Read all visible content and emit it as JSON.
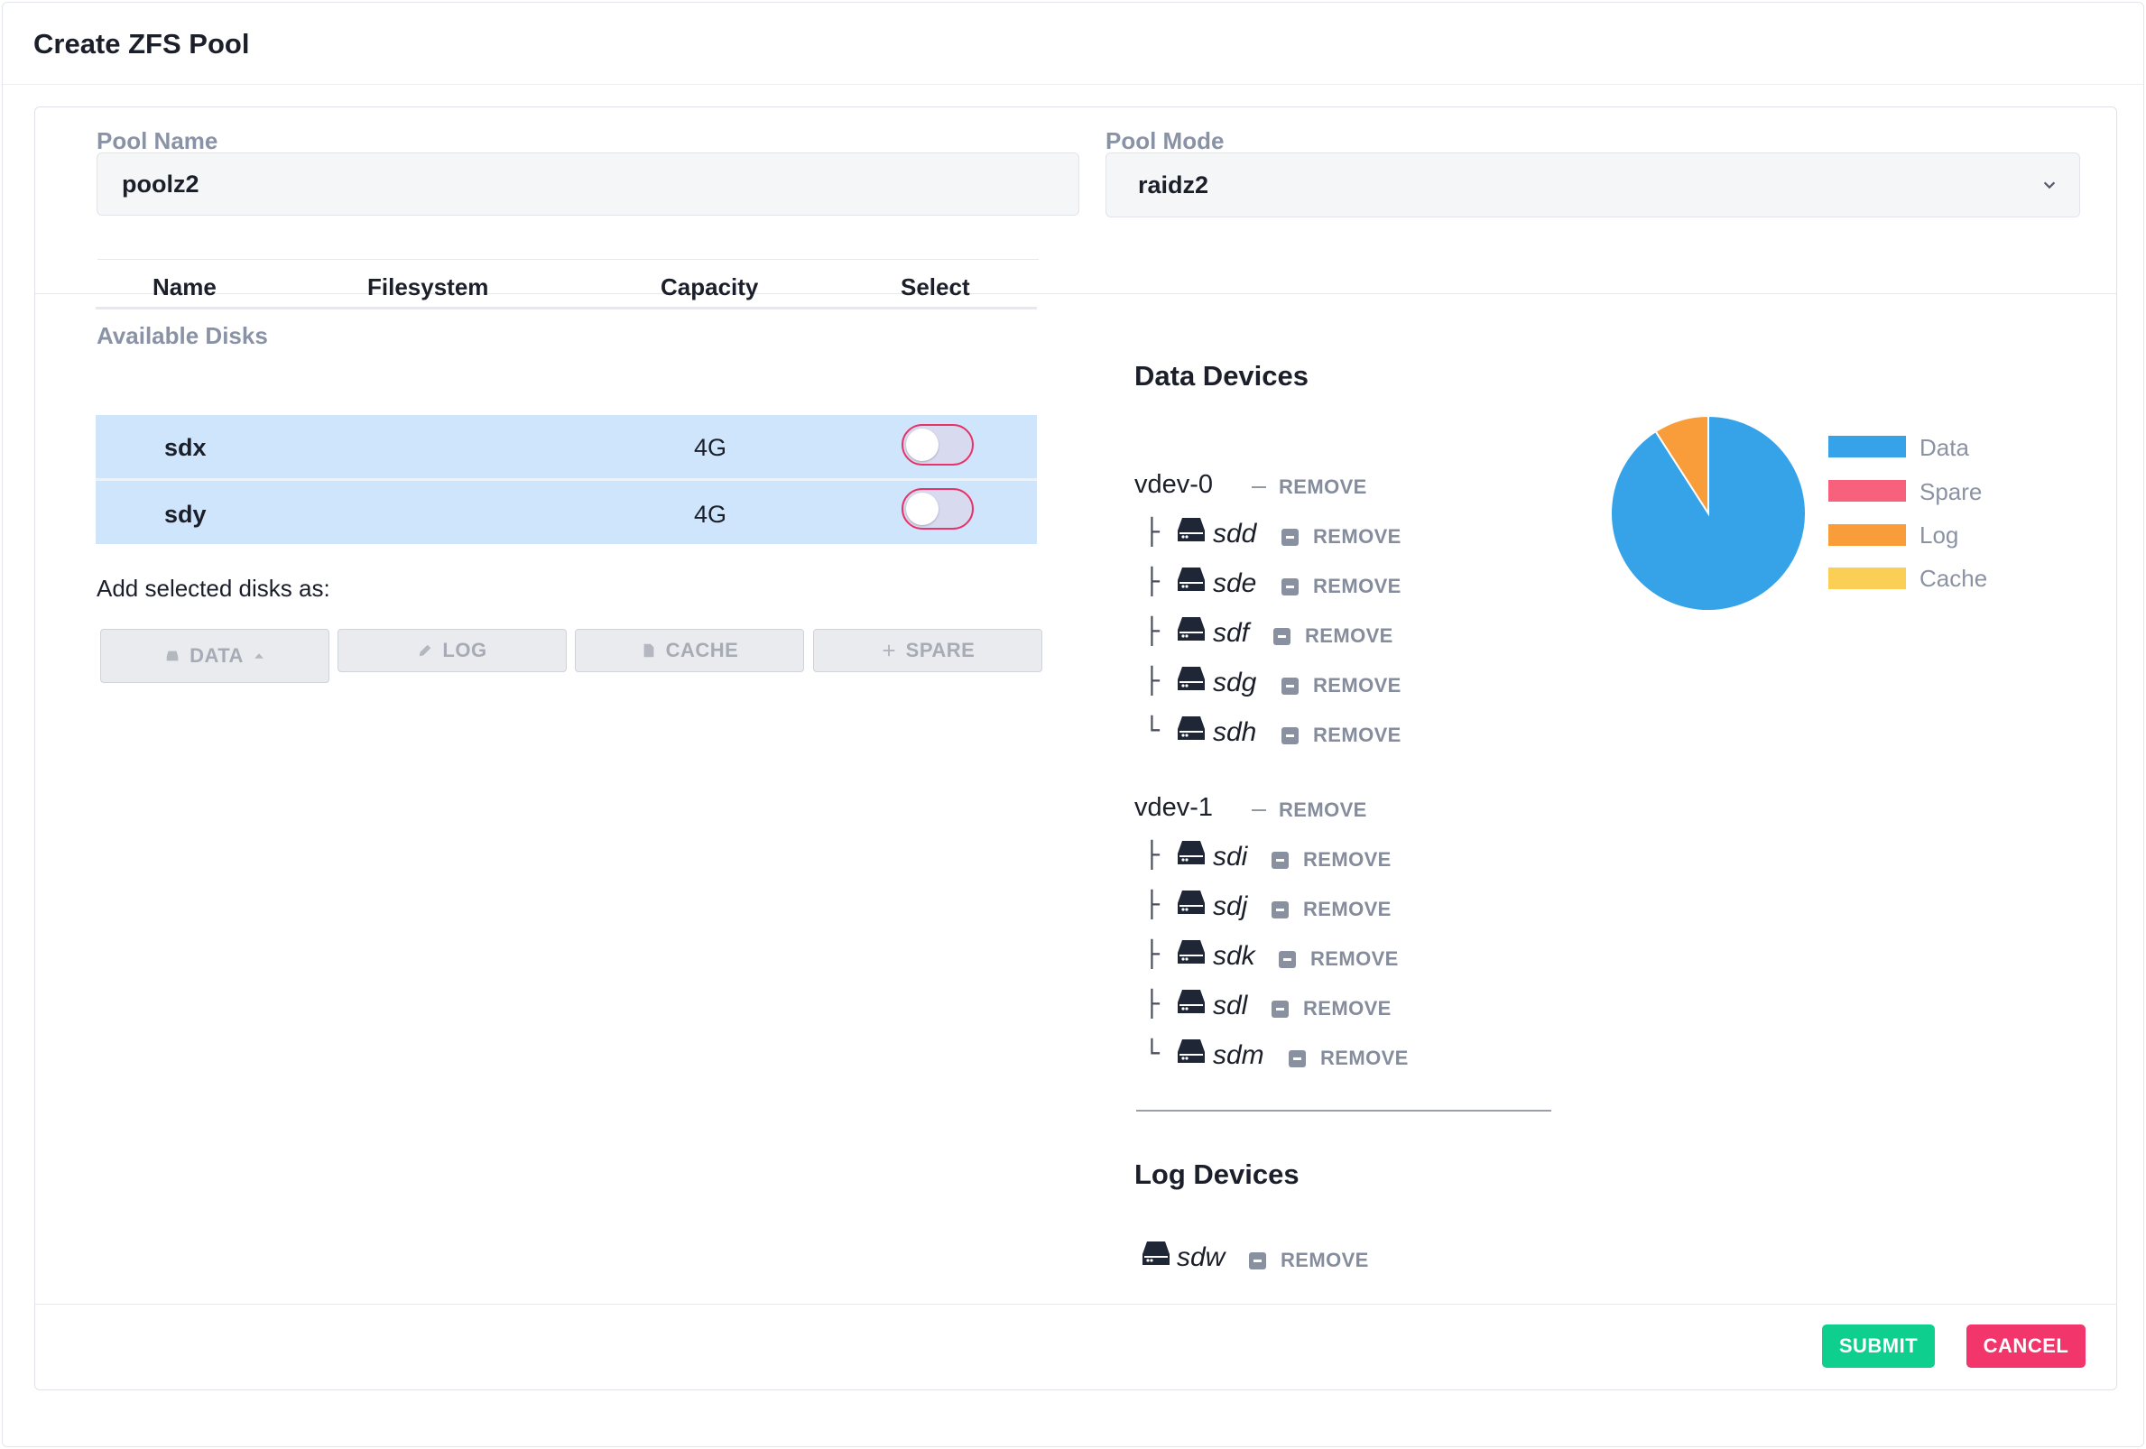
{
  "header": {
    "title": "Create ZFS Pool"
  },
  "form": {
    "pool_name_label": "Pool Name",
    "pool_name_value": "poolz2",
    "pool_mode_label": "Pool Mode",
    "pool_mode_value": "raidz2"
  },
  "disks": {
    "title": "Available Disks",
    "columns": [
      "Name",
      "Filesystem",
      "Capacity",
      "Select"
    ],
    "rows": [
      {
        "name": "sdx",
        "filesystem": "",
        "capacity": "4G",
        "selected": false
      },
      {
        "name": "sdy",
        "filesystem": "",
        "capacity": "4G",
        "selected": false
      }
    ],
    "add_label": "Add selected disks as:",
    "buttons": {
      "data": "DATA",
      "log": "LOG",
      "cache": "CACHE",
      "spare": "SPARE"
    }
  },
  "devices": {
    "data_title": "Data Devices",
    "remove_label": "REMOVE",
    "vdevs": [
      {
        "name": "vdev-0",
        "disks": [
          "sdd",
          "sde",
          "sdf",
          "sdg",
          "sdh"
        ]
      },
      {
        "name": "vdev-1",
        "disks": [
          "sdi",
          "sdj",
          "sdk",
          "sdl",
          "sdm"
        ]
      }
    ],
    "log_title": "Log Devices",
    "log_disks": [
      "sdw"
    ]
  },
  "chart_data": {
    "type": "pie",
    "categories": [
      "Data",
      "Spare",
      "Log",
      "Cache"
    ],
    "values": [
      10,
      0,
      1,
      0
    ],
    "colors": [
      "#36a2e8",
      "#f7617c",
      "#f99d3a",
      "#fbce56"
    ],
    "legend": "right"
  },
  "footer": {
    "submit": "SUBMIT",
    "cancel": "CANCEL"
  },
  "colors": {
    "submit": "#0fcf8e",
    "cancel": "#f2366c",
    "row_highlight": "#cfe5fb"
  }
}
